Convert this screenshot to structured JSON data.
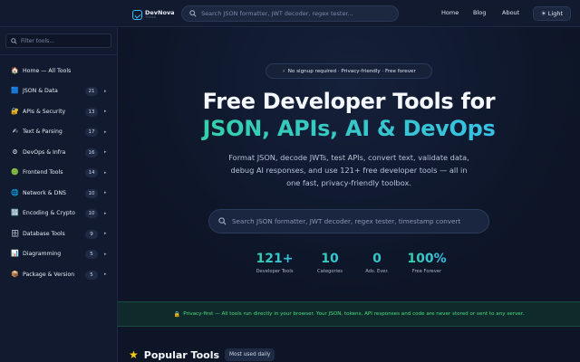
{
  "brand": {
    "name": "DevNova",
    "tagline": "TOOLS"
  },
  "header": {
    "search_placeholder": "Search JSON formatter, JWT decoder, regex tester...",
    "nav": [
      "Home",
      "Blog",
      "About"
    ],
    "theme_toggle": "Light",
    "theme_icon": "sun-icon"
  },
  "sidebar": {
    "filter_placeholder": "Filter tools...",
    "items": [
      {
        "label": "Home — All Tools",
        "icon": "house-icon",
        "glyph": "🏠",
        "count": null
      },
      {
        "label": "JSON & Data",
        "icon": "blue-square-icon",
        "glyph": "🟦",
        "count": "21"
      },
      {
        "label": "APIs & Security",
        "icon": "lock-key-icon",
        "glyph": "🔐",
        "count": "13"
      },
      {
        "label": "Text & Parsing",
        "icon": "writing-hand-icon",
        "glyph": "✍",
        "count": "17"
      },
      {
        "label": "DevOps & Infra",
        "icon": "gear-icon",
        "glyph": "⚙",
        "count": "16"
      },
      {
        "label": "Frontend Tools",
        "icon": "green-circle-icon",
        "glyph": "🟢",
        "count": "14"
      },
      {
        "label": "Network & DNS",
        "icon": "globe-icon",
        "glyph": "🌐",
        "count": "10"
      },
      {
        "label": "Encoding & Crypto",
        "icon": "numbers-icon",
        "glyph": "🔢",
        "count": "10"
      },
      {
        "label": "Database Tools",
        "icon": "cabinet-icon",
        "glyph": "🗄",
        "count": "9"
      },
      {
        "label": "Diagramming",
        "icon": "chart-icon",
        "glyph": "📊",
        "count": "5"
      },
      {
        "label": "Package & Version",
        "icon": "package-icon",
        "glyph": "📦",
        "count": "5"
      }
    ]
  },
  "hero": {
    "pill": "No signup required · Privacy-friendly · Free forever",
    "title_line1": "Free Developer Tools for",
    "title_line2": "JSON, APIs, AI & DevOps",
    "description": "Format JSON, decode JWTs, test APIs, convert text, validate data, debug AI responses, and use 121+ free developer tools — all in one fast, privacy-friendly toolbox.",
    "search_placeholder": "Search JSON formatter, JWT decoder, regex tester, timestamp convert"
  },
  "stats": [
    {
      "value": "121+",
      "label": "Developer Tools"
    },
    {
      "value": "10",
      "label": "Categories"
    },
    {
      "value": "0",
      "label": "Ads. Ever."
    },
    {
      "value": "100%",
      "label": "Free Forever"
    }
  ],
  "privacy_banner": "Privacy-first — All tools run directly in your browser. Your JSON, tokens, API responses and code are never stored or sent to any server.",
  "popular": {
    "title": "Popular Tools",
    "badge": "Most used daily"
  },
  "colors": {
    "accent_green": "#34d399",
    "accent_blue": "#38bdf8",
    "background": "#0d1527"
  }
}
